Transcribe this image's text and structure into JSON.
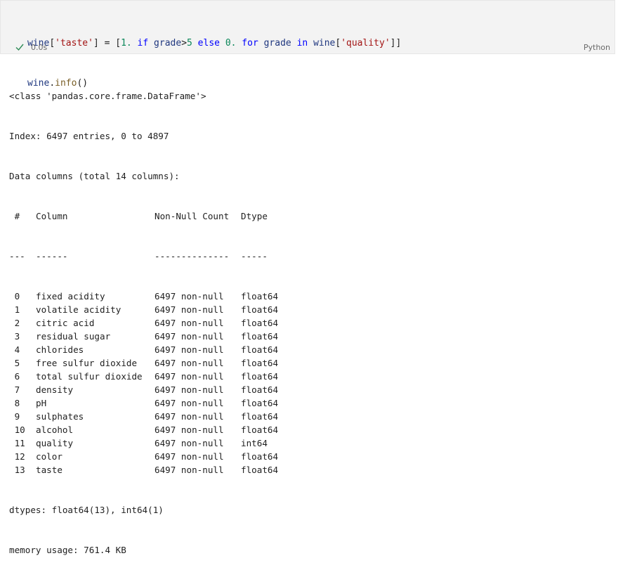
{
  "cell": {
    "code_line1": {
      "var": "wine",
      "open1": "[",
      "key": "'taste'",
      "close1": "]",
      "eq": " = [",
      "one": "1.",
      "if_kw": " if ",
      "grade1": "grade",
      "gt": ">",
      "five": "5",
      "else_kw": " else ",
      "zero": "0.",
      "for_kw": " for ",
      "grade2": "grade",
      "in_kw": " in ",
      "wine2": "wine",
      "open2": "[",
      "key2": "'quality'",
      "close2": "]]"
    },
    "code_line2": {
      "var": "wine",
      "dot": ".",
      "fn": "info",
      "parens": "()"
    },
    "exec_time": "0.0s",
    "language": "Python"
  },
  "output": {
    "header_lines": [
      "<class 'pandas.core.frame.DataFrame'>",
      "Index: 6497 entries, 0 to 4897",
      "Data columns (total 14 columns):"
    ],
    "table_header": {
      "idx": " #",
      "col": "Column",
      "nn": "Non-Null Count",
      "dt": "Dtype"
    },
    "table_sep": {
      "idx": "---",
      "col": "------",
      "nn": "--------------",
      "dt": "-----"
    },
    "rows": [
      {
        "idx": " 0",
        "col": "fixed acidity",
        "nn": "6497 non-null",
        "dt": "float64"
      },
      {
        "idx": " 1",
        "col": "volatile acidity",
        "nn": "6497 non-null",
        "dt": "float64"
      },
      {
        "idx": " 2",
        "col": "citric acid",
        "nn": "6497 non-null",
        "dt": "float64"
      },
      {
        "idx": " 3",
        "col": "residual sugar",
        "nn": "6497 non-null",
        "dt": "float64"
      },
      {
        "idx": " 4",
        "col": "chlorides",
        "nn": "6497 non-null",
        "dt": "float64"
      },
      {
        "idx": " 5",
        "col": "free sulfur dioxide",
        "nn": "6497 non-null",
        "dt": "float64"
      },
      {
        "idx": " 6",
        "col": "total sulfur dioxide",
        "nn": "6497 non-null",
        "dt": "float64"
      },
      {
        "idx": " 7",
        "col": "density",
        "nn": "6497 non-null",
        "dt": "float64"
      },
      {
        "idx": " 8",
        "col": "pH",
        "nn": "6497 non-null",
        "dt": "float64"
      },
      {
        "idx": " 9",
        "col": "sulphates",
        "nn": "6497 non-null",
        "dt": "float64"
      },
      {
        "idx": " 10",
        "col": "alcohol",
        "nn": "6497 non-null",
        "dt": "float64"
      },
      {
        "idx": " 11",
        "col": "quality",
        "nn": "6497 non-null",
        "dt": "int64"
      },
      {
        "idx": " 12",
        "col": "color",
        "nn": "6497 non-null",
        "dt": "float64"
      },
      {
        "idx": " 13",
        "col": "taste",
        "nn": "6497 non-null",
        "dt": "float64"
      }
    ],
    "footer_lines": [
      "dtypes: float64(13), int64(1)",
      "memory usage: 761.4 KB"
    ]
  }
}
